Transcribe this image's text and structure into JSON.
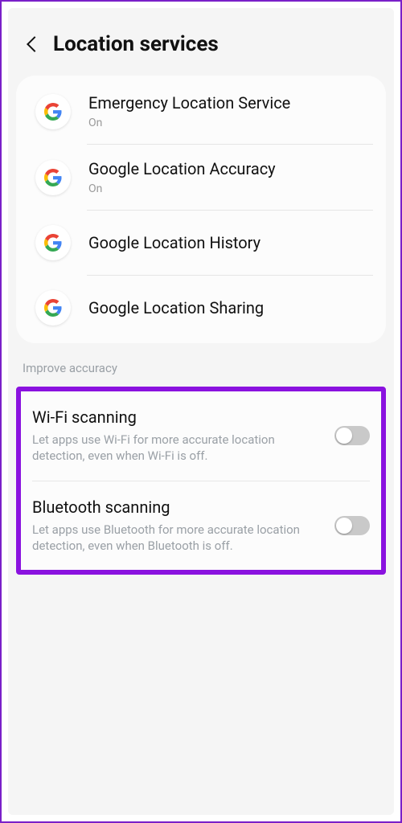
{
  "header": {
    "title": "Location services"
  },
  "googleItems": [
    {
      "title": "Emergency Location Service",
      "status": "On"
    },
    {
      "title": "Google Location Accuracy",
      "status": "On"
    },
    {
      "title": "Google Location History",
      "status": ""
    },
    {
      "title": "Google Location Sharing",
      "status": ""
    }
  ],
  "sectionLabel": "Improve accuracy",
  "accuracy": [
    {
      "title": "Wi-Fi scanning",
      "desc": "Let apps use Wi-Fi for more accurate location detection, even when Wi-Fi is off.",
      "enabled": false
    },
    {
      "title": "Bluetooth scanning",
      "desc": "Let apps use Bluetooth for more accurate location detection, even when Bluetooth is off.",
      "enabled": false
    }
  ]
}
